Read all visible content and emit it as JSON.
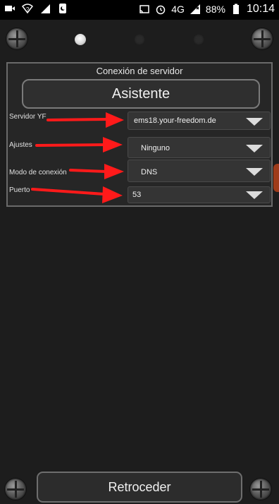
{
  "status_bar": {
    "icons_left": [
      "video-icon",
      "wifi-question-icon",
      "signal-question-icon",
      "phone-moon-icon"
    ],
    "icons_right": [
      "cast-icon",
      "alarm-icon",
      "lte-signal-icon",
      "battery-icon"
    ],
    "network": "4G",
    "battery": "88%",
    "time": "10:14"
  },
  "pager": {
    "pages": 3,
    "active_index": 0
  },
  "panel": {
    "title": "Conexión de servidor",
    "wizard_label": "Asistente",
    "fields": [
      {
        "label": "Servidor YF",
        "value": "ems18.your-freedom.de"
      },
      {
        "label": "Ajustes",
        "value": "Ninguno"
      },
      {
        "label": "Modo de conexión",
        "value": "DNS"
      },
      {
        "label": "Puerto",
        "value": "53"
      }
    ]
  },
  "footer": {
    "back_label": "Retroceder"
  },
  "colors": {
    "background": "#1d1d1d",
    "annotation_arrow": "#ff1a1a",
    "panel_border": "#6a6a6a"
  }
}
